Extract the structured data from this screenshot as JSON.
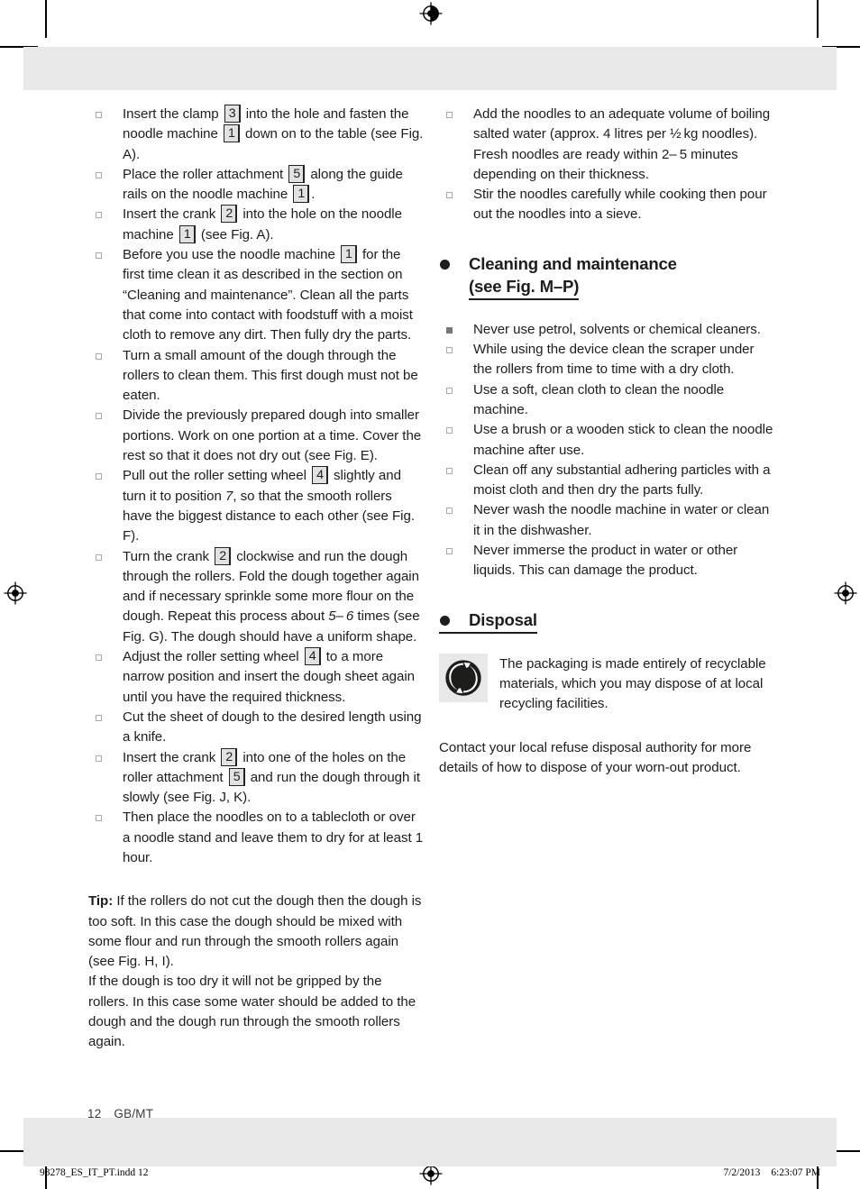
{
  "page": {
    "number": "12",
    "locale": "GB/MT"
  },
  "slug": {
    "file": "93278_ES_IT_PT.indd   12",
    "date": "7/2/2013",
    "time": "6:23:07 PM"
  },
  "left_column": {
    "steps": [
      {
        "parts": [
          {
            "t": "text",
            "v": "Insert the clamp "
          },
          {
            "t": "ref",
            "v": "3"
          },
          {
            "t": "text",
            "v": " into the hole and fasten the noodle machine "
          },
          {
            "t": "ref",
            "v": "1"
          },
          {
            "t": "text",
            "v": " down on to the table (see Fig. A)."
          }
        ]
      },
      {
        "parts": [
          {
            "t": "text",
            "v": "Place the roller attachment "
          },
          {
            "t": "ref",
            "v": "5"
          },
          {
            "t": "text",
            "v": " along the guide rails on the noodle machine "
          },
          {
            "t": "ref",
            "v": "1"
          },
          {
            "t": "text",
            "v": "."
          }
        ]
      },
      {
        "parts": [
          {
            "t": "text",
            "v": "Insert the crank "
          },
          {
            "t": "ref",
            "v": "2"
          },
          {
            "t": "text",
            "v": " into the hole on the noodle machine "
          },
          {
            "t": "ref",
            "v": "1"
          },
          {
            "t": "text",
            "v": " (see Fig. A)."
          }
        ]
      },
      {
        "parts": [
          {
            "t": "text",
            "v": "Before you use the noodle machine "
          },
          {
            "t": "ref",
            "v": "1"
          },
          {
            "t": "text",
            "v": " for the first time clean it as described in the section on “Cleaning and maintenance”. Clean all the parts that come into contact with foodstuff with a moist cloth to remove any dirt. Then fully dry the parts."
          }
        ]
      },
      {
        "parts": [
          {
            "t": "text",
            "v": "Turn a small amount of the dough through the rollers to clean them. This first dough must not be eaten."
          }
        ]
      },
      {
        "parts": [
          {
            "t": "text",
            "v": "Divide the previously prepared dough into smaller portions. Work on one portion at a time. Cover the rest so that it does not dry out (see Fig. E)."
          }
        ]
      },
      {
        "parts": [
          {
            "t": "text",
            "v": "Pull out the roller setting wheel "
          },
          {
            "t": "ref",
            "v": "4"
          },
          {
            "t": "text",
            "v": " slightly and turn it to position "
          },
          {
            "t": "italic",
            "v": "7"
          },
          {
            "t": "text",
            "v": ", so that the smooth rollers have the biggest distance to each other (see Fig. F)."
          }
        ]
      },
      {
        "parts": [
          {
            "t": "text",
            "v": "Turn the crank "
          },
          {
            "t": "ref",
            "v": "2"
          },
          {
            "t": "text",
            "v": " clockwise and run the dough through the rollers. Fold the dough together again and if necessary sprinkle some more flour on the dough. Repeat this process about "
          },
          {
            "t": "italic",
            "v": "5– 6"
          },
          {
            "t": "text",
            "v": " times (see Fig. G). The dough should have a uniform shape."
          }
        ]
      },
      {
        "parts": [
          {
            "t": "text",
            "v": "Adjust the roller setting wheel "
          },
          {
            "t": "ref",
            "v": "4"
          },
          {
            "t": "text",
            "v": " to a more narrow position and insert the dough sheet again until you have the required thickness."
          }
        ]
      },
      {
        "parts": [
          {
            "t": "text",
            "v": "Cut the sheet of dough to the desired length using a knife."
          }
        ]
      },
      {
        "parts": [
          {
            "t": "text",
            "v": "Insert the crank "
          },
          {
            "t": "ref",
            "v": "2"
          },
          {
            "t": "text",
            "v": " into one of the holes on the roller attachment "
          },
          {
            "t": "ref",
            "v": "5"
          },
          {
            "t": "text",
            "v": " and run the dough through it slowly (see Fig. J, K)."
          }
        ]
      },
      {
        "parts": [
          {
            "t": "text",
            "v": "Then place the noodles on to a tablecloth or over a noodle stand and leave them to dry for at least 1 hour."
          }
        ]
      }
    ],
    "tip": {
      "label": "Tip:",
      "paragraph1": " If the rollers do not cut the dough then the dough is too soft. In this case the dough should be mixed with some flour and run through the smooth rollers again (see Fig. H, I).",
      "paragraph2": "If the dough is too dry it will not be gripped by the rollers. In this case some water should be added to the dough and the dough run through the smooth rollers again."
    }
  },
  "right_column": {
    "cooking_steps": [
      {
        "parts": [
          {
            "t": "text",
            "v": "Add the noodles to an adequate volume of boiling salted water (approx. 4 litres per ½ kg noodles). Fresh noodles are ready within 2– 5 minutes depending on their thickness."
          }
        ]
      },
      {
        "parts": [
          {
            "t": "text",
            "v": "Stir the noodles carefully while cooking then pour out the noodles into a sieve."
          }
        ]
      }
    ],
    "cleaning_heading": {
      "line1": "Cleaning and maintenance",
      "line2": "(see Fig. M–P)"
    },
    "cleaning_steps": [
      {
        "filled": true,
        "parts": [
          {
            "t": "text",
            "v": "Never use petrol, solvents or chemical cleaners."
          }
        ]
      },
      {
        "filled": false,
        "parts": [
          {
            "t": "text",
            "v": "While using the device clean the scraper under the rollers from time to time with a dry cloth."
          }
        ]
      },
      {
        "filled": false,
        "parts": [
          {
            "t": "text",
            "v": "Use a soft, clean cloth to clean the noodle machine."
          }
        ]
      },
      {
        "filled": false,
        "parts": [
          {
            "t": "text",
            "v": "Use a brush or a wooden stick to clean the noodle machine after use."
          }
        ]
      },
      {
        "filled": false,
        "parts": [
          {
            "t": "text",
            "v": "Clean off any substantial adhering particles with a moist cloth and then dry the parts fully."
          }
        ]
      },
      {
        "filled": false,
        "parts": [
          {
            "t": "text",
            "v": "Never wash the noodle machine in water or clean it in the dishwasher."
          }
        ]
      },
      {
        "filled": false,
        "parts": [
          {
            "t": "text",
            "v": "Never immerse the product in water or other liquids. This can damage the product."
          }
        ]
      }
    ],
    "disposal_heading": "Disposal",
    "recycling_icon_name": "green-dot-recycling-icon",
    "recycling_text": "The packaging is made entirely of recy­clable materials, which you may dispose of at local recycling facilities.",
    "disposal_paragraph": "Contact your local refuse disposal authority for more details of how to dispose of your worn-out product."
  },
  "colors": {
    "band": "#e8e8e8",
    "text": "#1d1d1b",
    "ref_box_fill": "#e2e2e2",
    "ref_box_border": "#232323",
    "marker_outline": "#a9a9a9",
    "marker_filled": "#77777a"
  }
}
